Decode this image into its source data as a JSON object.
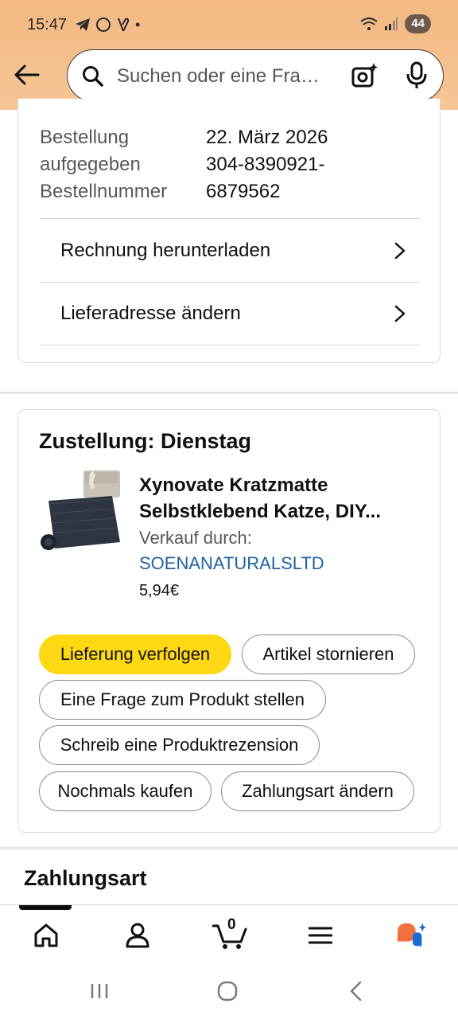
{
  "status_bar": {
    "time": "15:47",
    "battery": "44",
    "icons_left": [
      "telegram-icon",
      "whatsapp-icon",
      "app-icon",
      "dot-icon"
    ],
    "icons_right": [
      "wifi-icon",
      "signal-icon"
    ]
  },
  "header": {
    "search_placeholder": "Suchen oder eine Fra…",
    "icons": [
      "back-arrow-icon",
      "search-icon",
      "camera-icon",
      "microphone-icon"
    ]
  },
  "order_info": {
    "labels": [
      "Bestellung",
      "aufgegeben",
      "Bestellnummer"
    ],
    "values": [
      "22. März 2026",
      "304-8390921-",
      "6879562"
    ],
    "links": [
      {
        "label": "Rechnung herunterladen"
      },
      {
        "label": "Lieferadresse ändern"
      }
    ]
  },
  "delivery": {
    "title": "Zustellung: Dienstag",
    "product_title_line1": "Xynovate Kratzmatte",
    "product_title_line2": "Selbstklebend Katze, DIY...",
    "seller_label": "Verkauf durch:",
    "seller_name": "SOENANATURALSLTD",
    "price": "5,94€",
    "buttons": [
      {
        "label": "Lieferung verfolgen"
      },
      {
        "label": "Artikel stornieren"
      },
      {
        "label": "Eine Frage zum Produkt stellen"
      },
      {
        "label": "Schreib eine Produktrezension"
      },
      {
        "label": "Nochmals kaufen"
      },
      {
        "label": "Zahlungsart ändern"
      }
    ]
  },
  "payment": {
    "title": "Zahlungsart"
  },
  "bottom_nav": {
    "items": [
      "home-icon",
      "account-icon",
      "cart-icon",
      "menu-icon",
      "rufus-icon"
    ],
    "cart_count": "0"
  },
  "colors": {
    "header_bg": "#f4c08e",
    "primary_button": "#ffd814",
    "link": "#2162a1"
  }
}
